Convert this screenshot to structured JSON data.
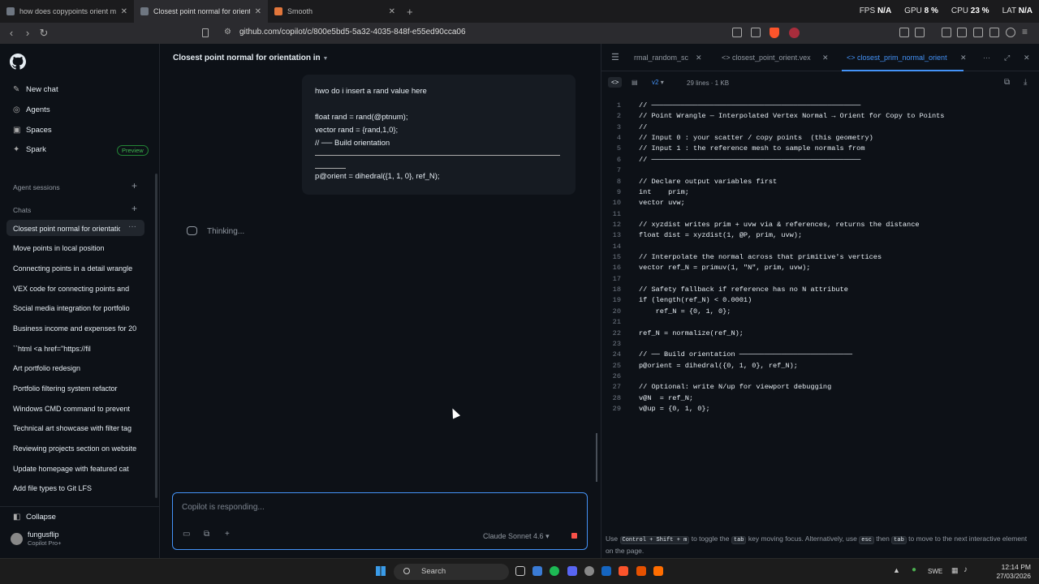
{
  "browser": {
    "tabs": [
      {
        "title": "how does copypoints orient meshes",
        "color": "#6e7681"
      },
      {
        "title": "Closest point normal for orientation",
        "color": "#6e7681"
      },
      {
        "title": "Smooth",
        "color": "#e2763b"
      }
    ],
    "url": "github.com/copilot/c/800e5bd5-5a32-4035-848f-e55ed90cca06",
    "hud": {
      "fps_label": "FPS",
      "fps": "N/A",
      "gpu_label": "GPU",
      "gpu": "8 %",
      "cpu_label": "CPU",
      "cpu": "23 %",
      "lat_label": "LAT",
      "lat": "N/A"
    }
  },
  "sidebar": {
    "nav": [
      {
        "label": "New chat",
        "icon": "compose-icon"
      },
      {
        "label": "Agents",
        "icon": "agent-icon"
      },
      {
        "label": "Spaces",
        "icon": "spaces-icon"
      },
      {
        "label": "Spark",
        "icon": "spark-icon"
      }
    ],
    "preview_badge": "Preview",
    "agent_sessions_label": "Agent sessions",
    "chats_label": "Chats",
    "chats": [
      "Closest point normal for orientation",
      "Move points in local position",
      "Connecting points in a detail wrangle",
      "VEX code for connecting points and",
      "Social media integration for portfolio",
      "Business income and expenses for 20",
      "``html <a href=\"https://fil",
      "Art portfolio redesign",
      "Portfolio filtering system refactor",
      "Windows CMD command to prevent",
      "Technical art showcase with filter tag",
      "Reviewing projects section on website",
      "Update homepage with featured cat",
      "Add file types to Git LFS"
    ],
    "collapse_label": "Collapse",
    "user": {
      "name": "fungusflip",
      "plan": "Copilot Pro+"
    }
  },
  "chat": {
    "title": "Closest point normal for orientation in",
    "user_message": {
      "line1": "hwo do i insert a rand value here",
      "line2": "float rand = rand(@ptnum);",
      "line3": "vector rand = {rand,1,0};",
      "line4": "// ── Build orientation",
      "line5": "p@orient = dihedral({1, 1, 0}, ref_N);"
    },
    "thinking": "Thinking...",
    "composer_placeholder": "Copilot is responding...",
    "model": "Claude Sonnet 4.6"
  },
  "code": {
    "tabs": [
      "rmal_random_sc",
      "closest_point_orient.vex",
      "closest_prim_normal_orient"
    ],
    "version": "v2",
    "meta": "29 lines · 1 KB",
    "lines": [
      "// ──────────────────────────────────────────────────",
      "// Point Wrangle — Interpolated Vertex Normal → Orient for Copy to Points",
      "//",
      "// Input 0 : your scatter / copy points  (this geometry)",
      "// Input 1 : the reference mesh to sample normals from",
      "// ──────────────────────────────────────────────────",
      "",
      "// Declare output variables first",
      "int    prim;",
      "vector uvw;",
      "",
      "// xyzdist writes prim + uvw via & references, returns the distance",
      "float dist = xyzdist(1, @P, prim, uvw);",
      "",
      "// Interpolate the normal across that primitive's vertices",
      "vector ref_N = primuv(1, \"N\", prim, uvw);",
      "",
      "// Safety fallback if reference has no N attribute",
      "if (length(ref_N) < 0.0001)",
      "    ref_N = {0, 1, 0};",
      "",
      "ref_N = normalize(ref_N);",
      "",
      "// ── Build orientation ───────────────────────────",
      "p@orient = dihedral({0, 1, 0}, ref_N);",
      "",
      "// Optional: write N/up for viewport debugging",
      "v@N  = ref_N;",
      "v@up = {0, 1, 0};"
    ],
    "hint": {
      "use": "Use",
      "k1": "Control + Shift + m",
      "t1": "to toggle the",
      "k2": "tab",
      "t2": "key moving focus. Alternatively, use",
      "k3": "esc",
      "t3": "then",
      "k4": "tab",
      "t4": "to move to the next interactive element on the page."
    }
  },
  "taskbar": {
    "search": "Search",
    "lang": "SWE",
    "time": "12:14 PM",
    "date": "27/03/2026"
  }
}
